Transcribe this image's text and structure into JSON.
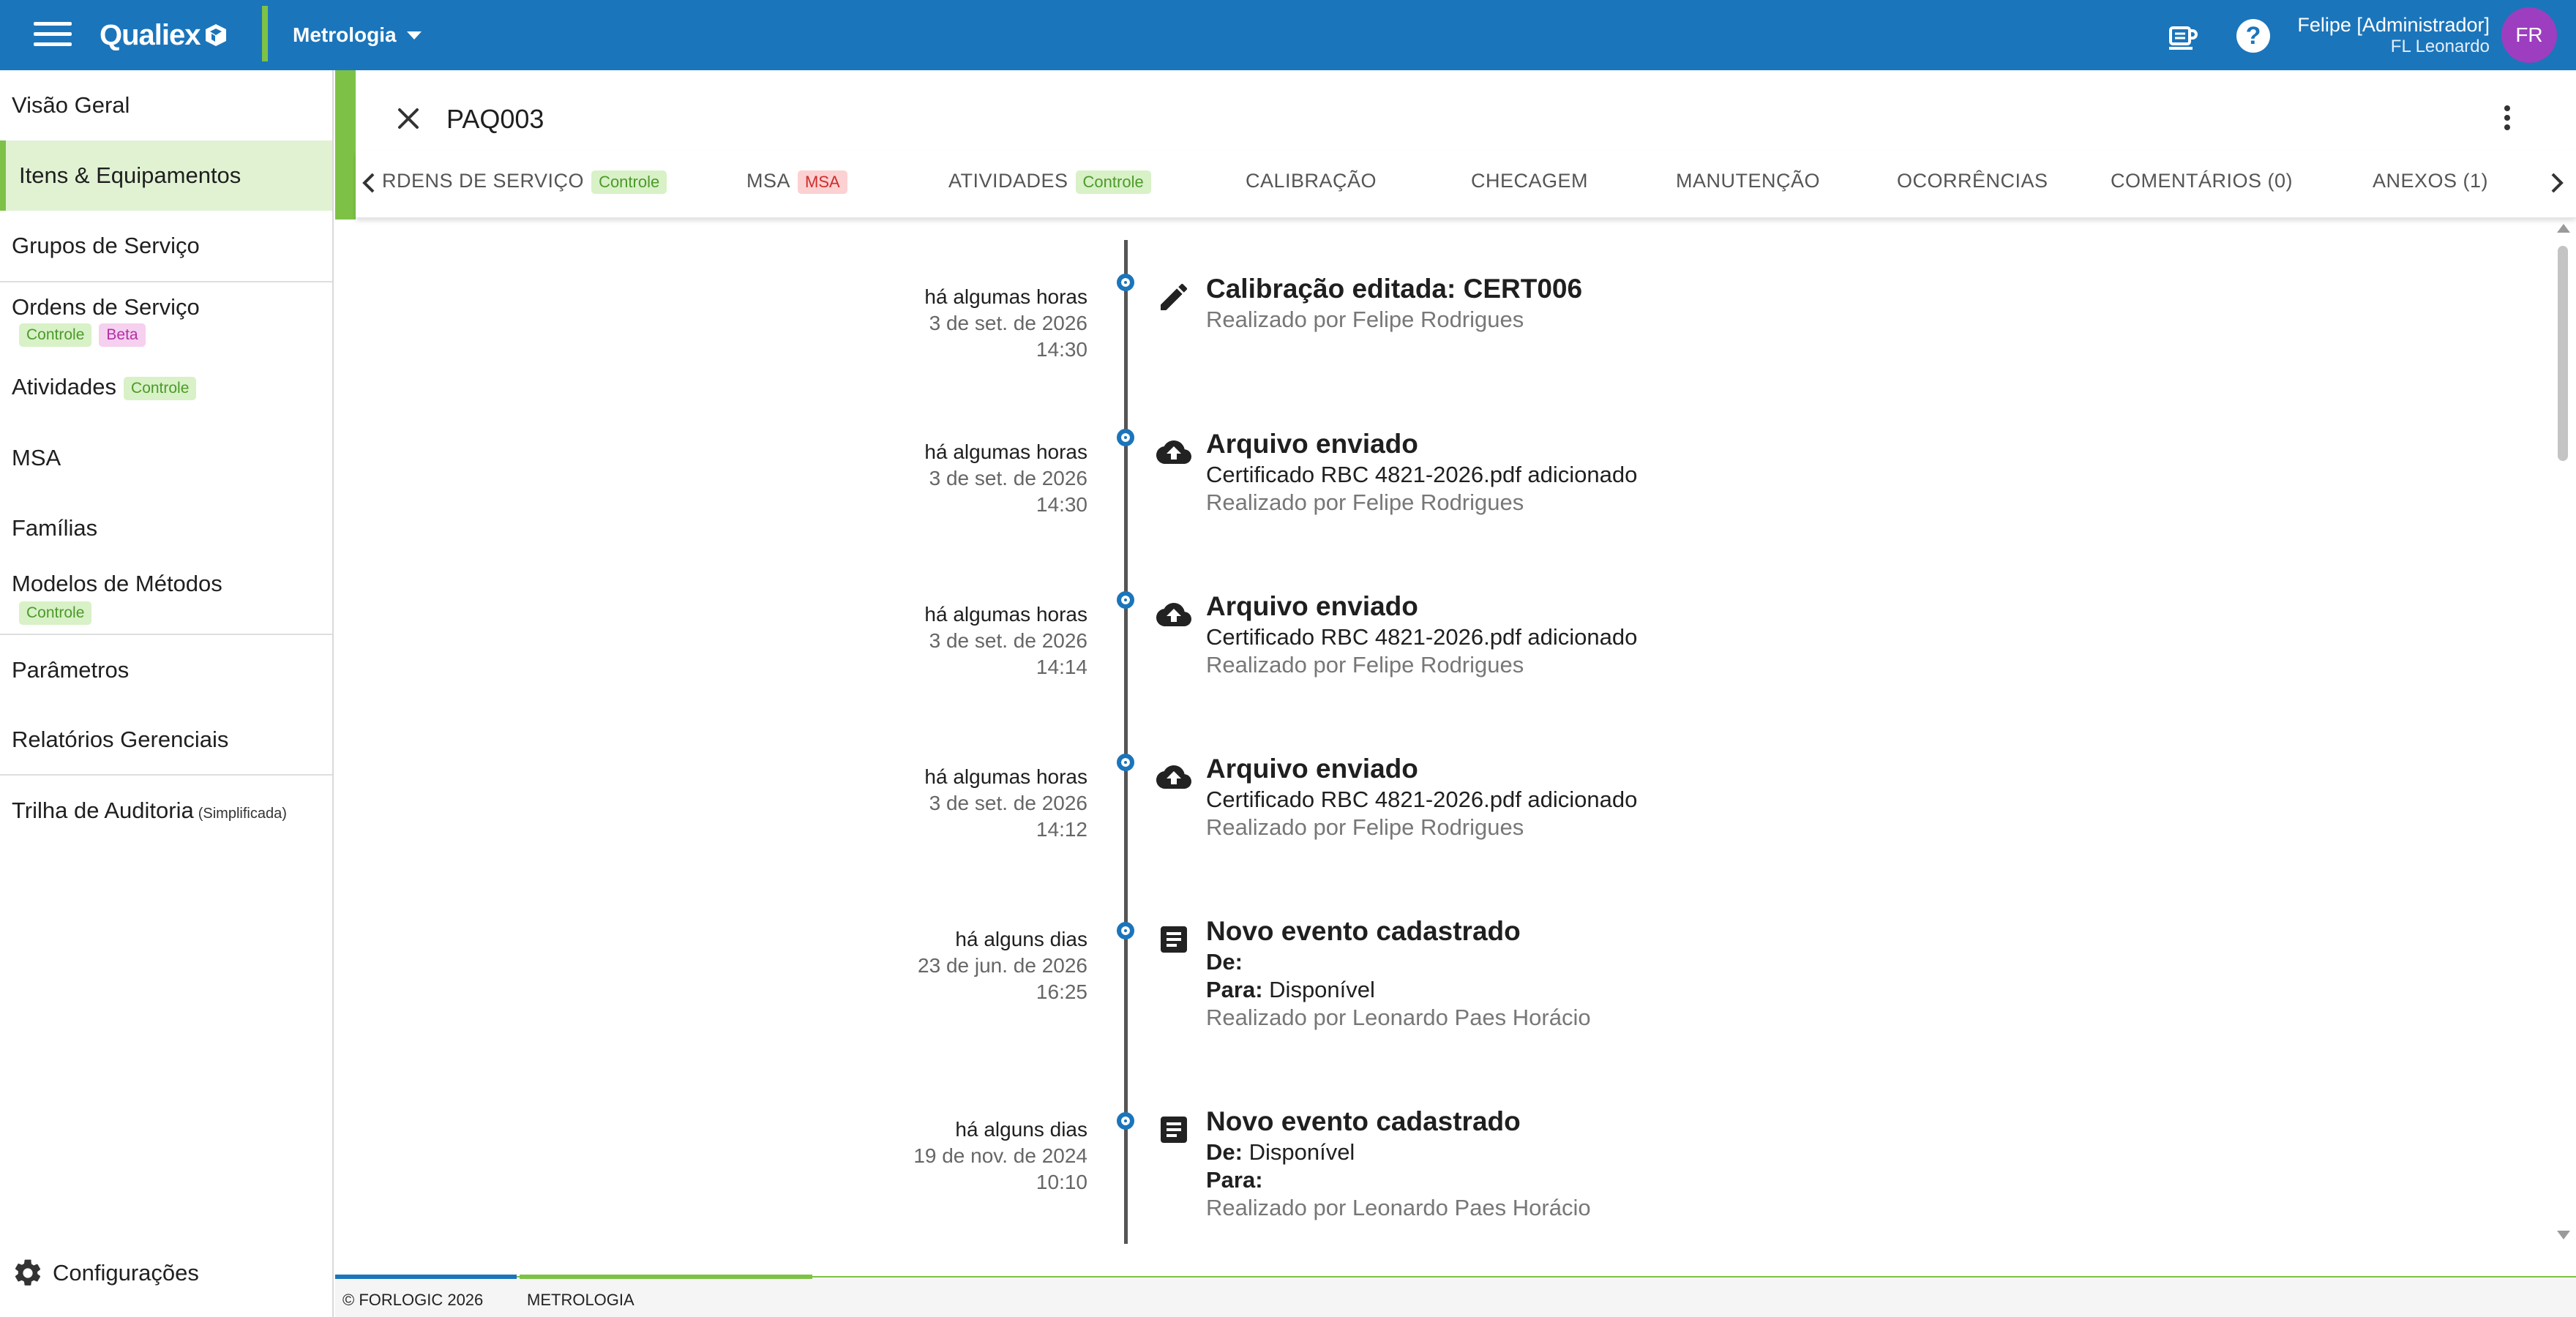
{
  "topbar": {
    "logo_text": "Qualiex",
    "module": "Metrologia",
    "user_name": "Felipe [Administrador]",
    "user_org": "FL Leonardo",
    "avatar_initials": "FR",
    "help_glyph": "?"
  },
  "sidebar": {
    "items": [
      {
        "label": "Visão Geral"
      },
      {
        "label": "Itens & Equipamentos",
        "active": true
      },
      {
        "label": "Grupos de Serviço"
      },
      {
        "label": "Ordens de Serviço",
        "badges": [
          "Controle",
          "Beta"
        ]
      },
      {
        "label": "Atividades",
        "badges": [
          "Controle"
        ]
      },
      {
        "label": "MSA"
      },
      {
        "label": "Famílias"
      },
      {
        "label": "Modelos de Métodos",
        "badges": [
          "Controle"
        ]
      },
      {
        "label": "Parâmetros"
      },
      {
        "label": "Relatórios Gerenciais"
      },
      {
        "label": "Trilha de Auditoria",
        "suffix": "(Simplificada)"
      }
    ],
    "config_label": "Configurações"
  },
  "panel": {
    "title": "PAQ003",
    "tabs": [
      {
        "label": "RDENS DE SERVIÇO",
        "badge": "Controle"
      },
      {
        "label": "MSA",
        "badge": "MSA"
      },
      {
        "label": "ATIVIDADES",
        "badge": "Controle"
      },
      {
        "label": "CALIBRAÇÃO"
      },
      {
        "label": "CHECAGEM"
      },
      {
        "label": "MANUTENÇÃO"
      },
      {
        "label": "OCORRÊNCIAS"
      },
      {
        "label": "COMENTÁRIOS (0)"
      },
      {
        "label": "ANEXOS (1)"
      }
    ]
  },
  "timeline": {
    "events": [
      {
        "icon": "pencil-icon",
        "relative": "há algumas horas",
        "date": "3 de set. de 2026",
        "time": "14:30",
        "title": "Calibração editada: CERT006",
        "detail": "",
        "by": "Realizado por Felipe Rodrigues"
      },
      {
        "icon": "cloud-upload-icon",
        "relative": "há algumas horas",
        "date": "3 de set. de 2026",
        "time": "14:30",
        "title": "Arquivo enviado",
        "detail": "Certificado RBC 4821-2026.pdf adicionado",
        "by": "Realizado por Felipe Rodrigues"
      },
      {
        "icon": "cloud-upload-icon",
        "relative": "há algumas horas",
        "date": "3 de set. de 2026",
        "time": "14:14",
        "title": "Arquivo enviado",
        "detail": "Certificado RBC 4821-2026.pdf adicionado",
        "by": "Realizado por Felipe Rodrigues"
      },
      {
        "icon": "cloud-upload-icon",
        "relative": "há algumas horas",
        "date": "3 de set. de 2026",
        "time": "14:12",
        "title": "Arquivo enviado",
        "detail": "Certificado RBC 4821-2026.pdf adicionado",
        "by": "Realizado por Felipe Rodrigues"
      },
      {
        "icon": "document-icon",
        "relative": "há alguns dias",
        "date": "23 de jun. de 2026",
        "time": "16:25",
        "title": "Novo evento cadastrado",
        "from_label": "De:",
        "from_value": "",
        "to_label": "Para:",
        "to_value": "Disponível",
        "by": "Realizado por Leonardo Paes Horácio"
      },
      {
        "icon": "document-icon",
        "relative": "há alguns dias",
        "date": "19 de nov. de 2024",
        "time": "10:10",
        "title": "Novo evento cadastrado",
        "from_label": "De:",
        "from_value": "Disponível",
        "to_label": "Para:",
        "to_value": "",
        "by": "Realizado por Leonardo Paes Horácio"
      }
    ]
  },
  "footer": {
    "copyright": "© FORLOGIC 2026",
    "module": "METROLOGIA"
  },
  "colors": {
    "brand_blue": "#1b75bb",
    "accent_green": "#7dc246",
    "active_bg": "#e1f2d3"
  }
}
